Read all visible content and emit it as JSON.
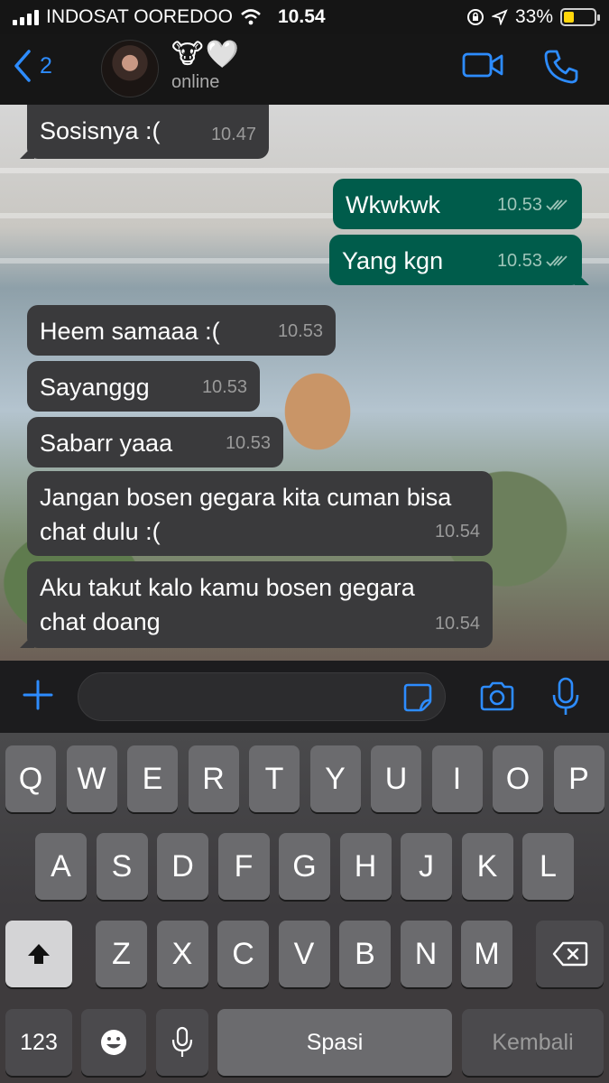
{
  "status_bar": {
    "carrier": "INDOSAT OOREDOO",
    "time": "10.54",
    "battery": "33%",
    "battery_level": 0.33
  },
  "header": {
    "back_count": "2",
    "contact_name": "🐮🤍",
    "contact_status": "online"
  },
  "messages": [
    {
      "dir": "in",
      "text": "Sosisnya :(",
      "time": "10.47"
    },
    {
      "dir": "out",
      "text": "Wkwkwk",
      "time": "10.53"
    },
    {
      "dir": "out",
      "text": "Yang kgn",
      "time": "10.53"
    },
    {
      "dir": "in",
      "text": "Heem samaaa :(",
      "time": "10.53"
    },
    {
      "dir": "in",
      "text": "Sayanggg",
      "time": "10.53"
    },
    {
      "dir": "in",
      "text": "Sabarr yaaa",
      "time": "10.53"
    },
    {
      "dir": "in",
      "text": "Jangan bosen gegara kita cuman bisa chat dulu :(",
      "time": "10.54"
    },
    {
      "dir": "in",
      "text": "Aku takut kalo kamu bosen gegara chat doang",
      "time": "10.54"
    }
  ],
  "input": {
    "placeholder": ""
  },
  "keyboard": {
    "row1": [
      "Q",
      "W",
      "E",
      "R",
      "T",
      "Y",
      "U",
      "I",
      "O",
      "P"
    ],
    "row2": [
      "A",
      "S",
      "D",
      "F",
      "G",
      "H",
      "J",
      "K",
      "L"
    ],
    "row3": [
      "Z",
      "X",
      "C",
      "V",
      "B",
      "N",
      "M"
    ],
    "numbers_label": "123",
    "space_label": "Spasi",
    "return_label": "Kembali"
  },
  "colors": {
    "accent": "#2d8cff",
    "outgoing_bubble": "#005c4b",
    "incoming_bubble": "#3a3a3c",
    "battery": "#ffd60a"
  }
}
